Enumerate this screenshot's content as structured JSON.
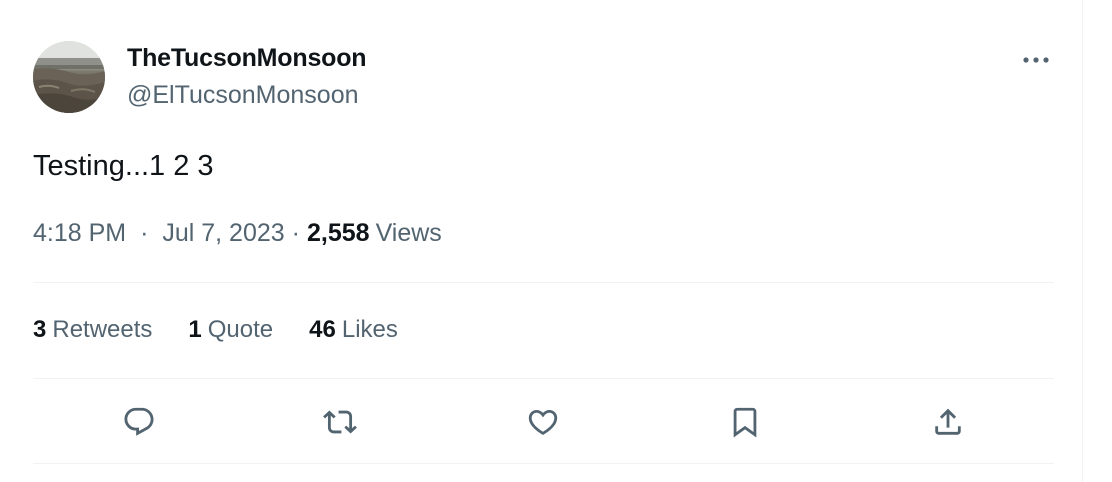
{
  "tweet": {
    "display_name": "TheTucsonMonsoon",
    "handle": "@ElTucsonMonsoon",
    "text": "Testing...1 2 3",
    "time": "4:18 PM",
    "separator": "·",
    "date": "Jul 7, 2023",
    "views_count": "2,558",
    "views_label": "Views"
  },
  "stats": {
    "retweets_count": "3",
    "retweets_label": "Retweets",
    "quotes_count": "1",
    "quotes_label": "Quote",
    "likes_count": "46",
    "likes_label": "Likes"
  },
  "icons": {
    "more": "more-horizontal-icon",
    "reply": "reply-icon",
    "retweet": "retweet-icon",
    "like": "heart-icon",
    "bookmark": "bookmark-icon",
    "share": "share-icon"
  },
  "colors": {
    "primary_text": "#0f1419",
    "secondary_text": "#536471",
    "divider": "#eff3f4"
  }
}
